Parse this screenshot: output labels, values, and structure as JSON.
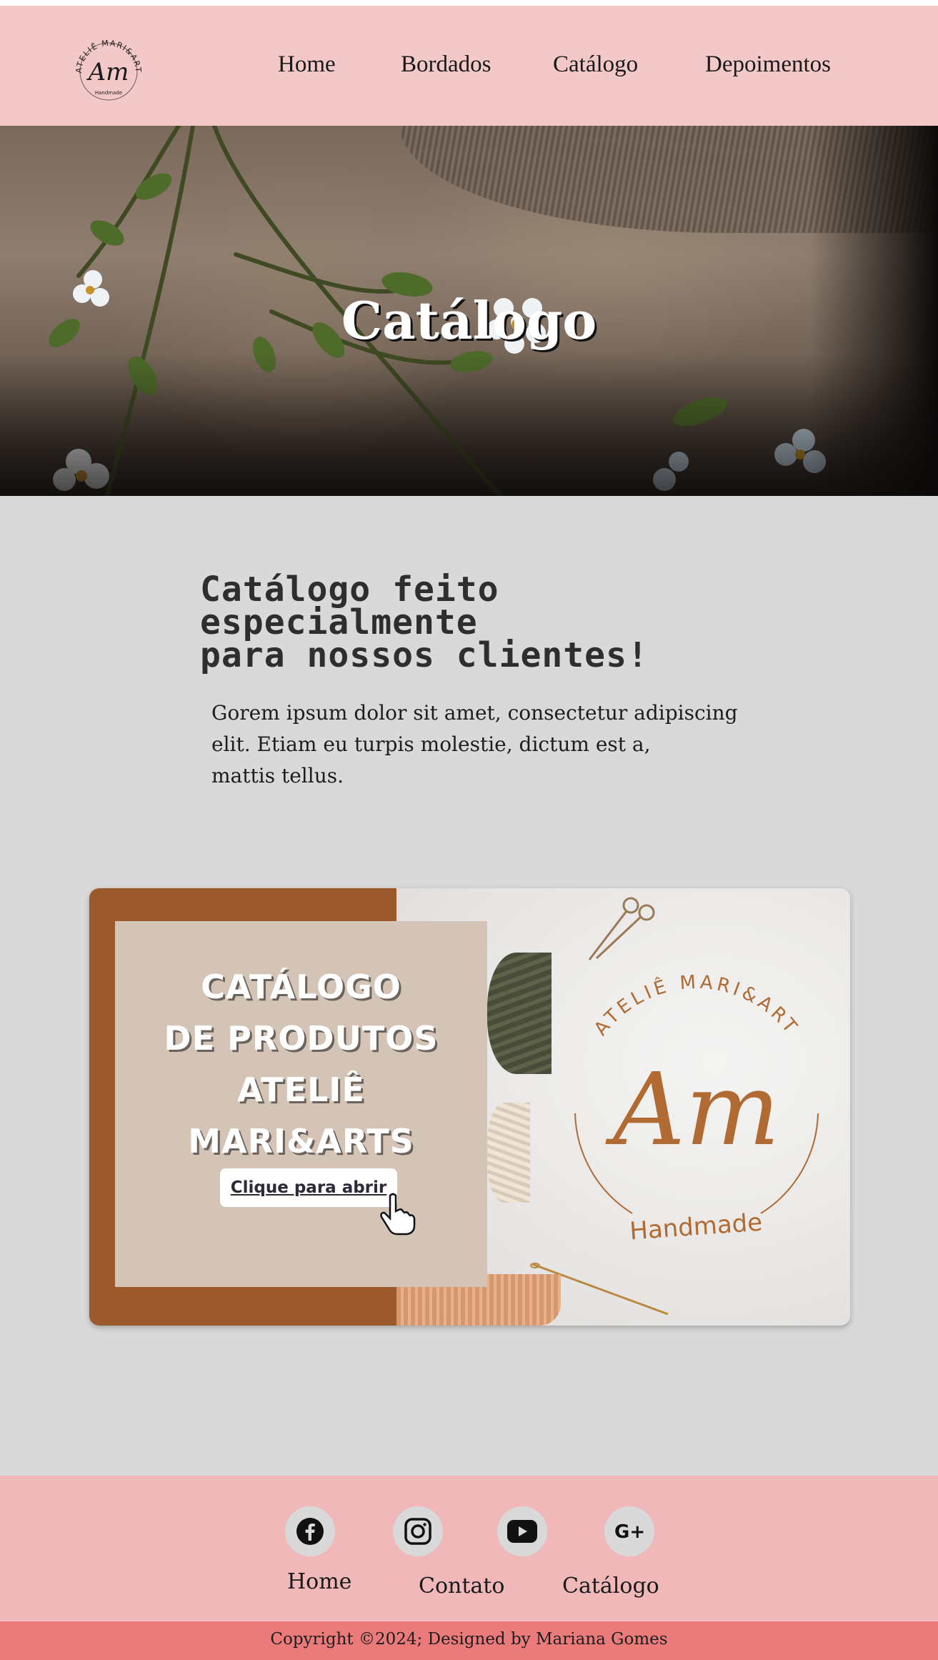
{
  "header": {
    "logo": {
      "brand_text": "ATELIÊ MARI&ART",
      "monogram": "Am",
      "tagline": "Handmade"
    },
    "nav": [
      {
        "label": "Home"
      },
      {
        "label": "Bordados"
      },
      {
        "label": "Catálogo"
      },
      {
        "label": "Depoimentos"
      }
    ]
  },
  "hero": {
    "title": "Catálogo"
  },
  "intro": {
    "headline_line1": "Catálogo feito especialmente",
    "headline_line2": "para nossos clientes!",
    "body_line1": "Gorem ipsum dolor sit amet, consectetur adipiscing",
    "body_line2": "elit. Etiam eu turpis molestie, dictum est a,",
    "body_line3": "mattis tellus."
  },
  "catalog_card": {
    "title_lines": [
      "CATÁLOGO",
      "DE PRODUTOS",
      "ATELIÊ",
      "MARI&ARTS"
    ],
    "button_label": "Clique para abrir",
    "emblem": {
      "brand_text": "ATELIÊ MARI&ART",
      "monogram": "Am",
      "tagline": "Handmade"
    }
  },
  "footer": {
    "social_icons": [
      "facebook-icon",
      "instagram-icon",
      "youtube-icon",
      "google-plus-icon"
    ],
    "links": [
      {
        "label": "Home"
      },
      {
        "label": "Contato"
      },
      {
        "label": "Catálogo"
      }
    ],
    "copyright": "Copyright ©2024; Designed by Mariana Gomes"
  },
  "colors": {
    "header_bg": "#f2c9c8",
    "page_bg": "#d9d9d9",
    "card_brown": "#9c5a2c",
    "card_panel": "#d4c4b6",
    "emblem_accent": "#b06a32",
    "footer_bg": "#f0b8b8",
    "copyright_bg": "#eb7b7a"
  }
}
